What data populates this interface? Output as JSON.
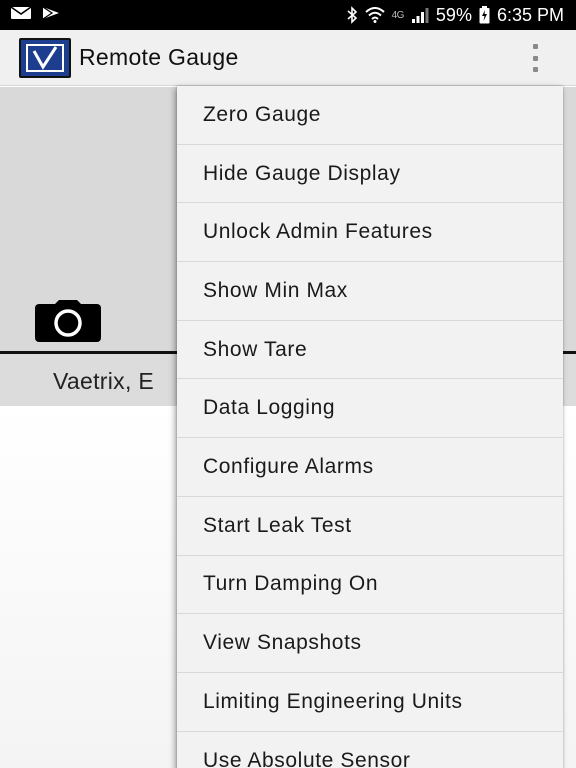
{
  "status_bar": {
    "network_type": "4G",
    "battery_percent": "59%",
    "time": "6:35 PM",
    "icons": [
      "mail-icon",
      "play-store-icon",
      "bluetooth-icon",
      "wifi-icon",
      "signal-icon",
      "battery-icon"
    ]
  },
  "app_bar": {
    "title": "Remote Gauge",
    "logo_letter": "V",
    "logo_color": "#1d3d8f"
  },
  "main": {
    "device_name": "Vaetrix, E"
  },
  "menu": {
    "items": [
      {
        "label": "Zero Gauge"
      },
      {
        "label": "Hide Gauge Display"
      },
      {
        "label": "Unlock Admin Features"
      },
      {
        "label": "Show Min Max"
      },
      {
        "label": "Show Tare"
      },
      {
        "label": "Data Logging"
      },
      {
        "label": "Configure Alarms"
      },
      {
        "label": "Start Leak Test"
      },
      {
        "label": "Turn Damping On"
      },
      {
        "label": "View Snapshots"
      },
      {
        "label": "Limiting Engineering Units"
      },
      {
        "label": "Use Absolute Sensor"
      }
    ]
  }
}
